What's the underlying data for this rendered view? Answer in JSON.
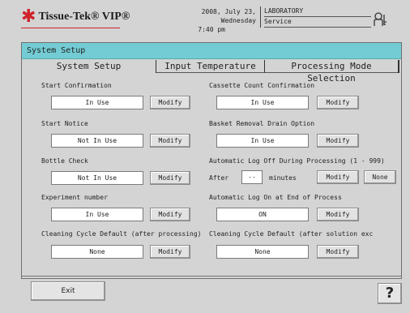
{
  "header": {
    "logo_text": "Tissue-Tek® VIP®",
    "date": "2008, July 23, Wednesday",
    "time": "7:40 pm",
    "location": "LABORATORY",
    "user_mode": "Service",
    "user_icon": "user-key-icon"
  },
  "panel": {
    "title": "System Setup",
    "tabs": [
      {
        "label": "System Setup",
        "active": true
      },
      {
        "label": "Input Temperature",
        "active": false
      },
      {
        "label": "Processing Mode Selection",
        "active": false
      }
    ]
  },
  "settings": {
    "start_confirmation": {
      "label": "Start Confirmation",
      "value": "In Use",
      "button": "Modify"
    },
    "start_notice": {
      "label": "Start Notice",
      "value": "Not In Use",
      "button": "Modify"
    },
    "bottle_check": {
      "label": "Bottle Check",
      "value": "Not In Use",
      "button": "Modify"
    },
    "experiment_number": {
      "label": "Experiment number",
      "value": "In Use",
      "button": "Modify"
    },
    "cleaning_default_after_processing": {
      "label": "Cleaning Cycle Default (after processing)",
      "value": "None",
      "button": "Modify"
    },
    "cassette_count_confirmation": {
      "label": "Cassette Count Confirmation",
      "value": "In Use",
      "button": "Modify"
    },
    "basket_removal_drain": {
      "label": "Basket Removal Drain Option",
      "value": "In Use",
      "button": "Modify"
    },
    "auto_logoff": {
      "label": "Automatic Log Off During Processing (1 - 999)",
      "prefix": "After",
      "value": "--",
      "suffix": "minutes",
      "button": "Modify",
      "button2": "None"
    },
    "auto_logon": {
      "label": "Automatic Log On at End of Process",
      "value": "ON",
      "button": "Modify"
    },
    "cleaning_default_after_solution": {
      "label": "Cleaning Cycle Default (after solution exc",
      "value": "None",
      "button": "Modify"
    }
  },
  "footer": {
    "exit_label": "Exit",
    "help_label": "?"
  },
  "colors": {
    "titlebar": "#73ccd3",
    "logo_accent": "#d0232a",
    "background": "#d4d4d4"
  }
}
